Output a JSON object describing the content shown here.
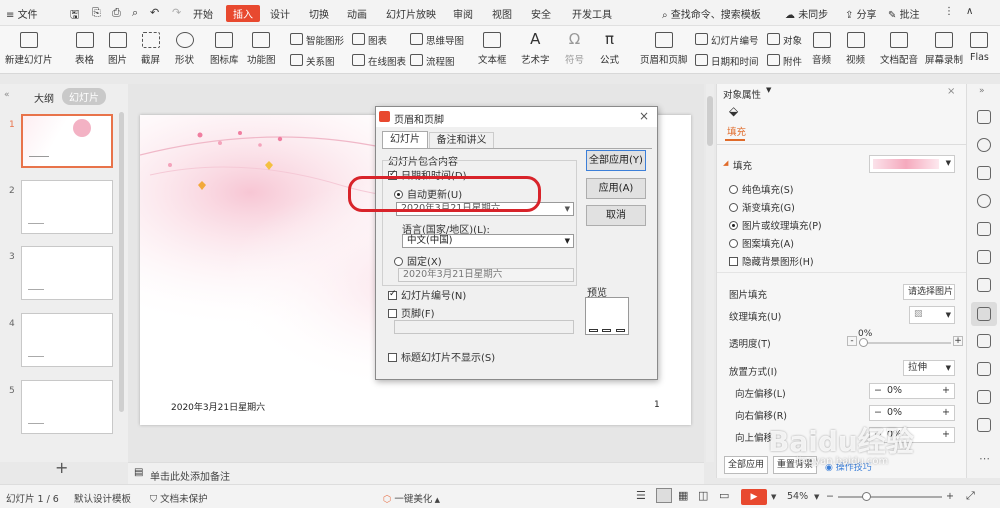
{
  "menu": {
    "file": "文件",
    "tabs": [
      "开始",
      "插入",
      "设计",
      "切换",
      "动画",
      "幻灯片放映",
      "审阅",
      "视图",
      "安全",
      "开发工具"
    ],
    "active_tab": "插入",
    "search": "查找命令、搜索模板",
    "sync": "未同步",
    "share": "分享",
    "comment": "批注"
  },
  "ribbon": {
    "new_slide": "新建幻灯片",
    "table": "表格",
    "picture": "图片",
    "screenshot": "截屏",
    "shape": "形状",
    "icon_lib": "图标库",
    "func_chart": "功能图",
    "smart_shape": "智能图形",
    "chart": "图表",
    "mindmap": "思维导图",
    "relation": "关系图",
    "online_chart": "在线图表",
    "flowchart": "流程图",
    "textbox": "文本框",
    "art_text": "艺术字",
    "symbol": "符号",
    "formula": "公式",
    "header_footer": "页眉和页脚",
    "slide_number": "幻灯片编号",
    "object": "对象",
    "datetime": "日期和时间",
    "attachment": "附件",
    "audio": "音频",
    "video": "视频",
    "doc_audio": "文档配音",
    "screen_record": "屏幕录制",
    "flash": "Flas"
  },
  "left_panel": {
    "tab_outline": "大纲",
    "tab_slides": "幻灯片",
    "slide_numbers": [
      "1",
      "2",
      "3",
      "4",
      "5"
    ]
  },
  "slide": {
    "date_text": "2020年3月21日星期六",
    "page_number": "1"
  },
  "dialog": {
    "title": "页眉和页脚",
    "tab_slide": "幻灯片",
    "tab_notes": "备注和讲义",
    "group_label": "幻灯片包含内容",
    "datetime_label": "日期和时间(D)",
    "auto_update": "自动更新(U)",
    "auto_value": "2020年3月21日星期六",
    "language_label": "语言(国家/地区)(L):",
    "language_value": "中文(中国)",
    "fixed": "固定(X)",
    "fixed_value": "2020年3月21日星期六",
    "slide_number": "幻灯片编号(N)",
    "footer": "页脚(F)",
    "no_title": "标题幻灯片不显示(S)",
    "preview": "预览",
    "btn_apply_all": "全部应用(Y)",
    "btn_apply": "应用(A)",
    "btn_cancel": "取消",
    "highlight_color": "#d8232a"
  },
  "right_panel": {
    "title": "对象属性",
    "fill_tab": "填充",
    "fill_header": "填充",
    "solid": "纯色填充(S)",
    "gradient": "渐变填充(G)",
    "picture_fill": "图片或纹理填充(P)",
    "pattern": "图案填充(A)",
    "hide_bg": "隐藏背景图形(H)",
    "pic_fill_label": "图片填充",
    "pic_fill_value": "请选择图片",
    "texture_label": "纹理填充(U)",
    "transparency_label": "透明度(T)",
    "transparency_value": "0%",
    "placement_label": "放置方式(I)",
    "placement_value": "拉伸",
    "offset_left": "向左偏移(L)",
    "offset_right": "向右偏移(R)",
    "offset_up": "向上偏移",
    "offset_value": "0%",
    "btn_apply_all": "全部应用",
    "btn_reset": "重置背景",
    "tips": "操作技巧"
  },
  "notes": {
    "placeholder": "单击此处添加备注"
  },
  "status": {
    "slide_info": "幻灯片 1 / 6",
    "template": "默认设计模板",
    "protect": "文档未保护",
    "beautify": "一键美化",
    "zoom": "54%"
  },
  "watermark": "Baidu经验",
  "watermark_url": "jingyan.baidu.com"
}
